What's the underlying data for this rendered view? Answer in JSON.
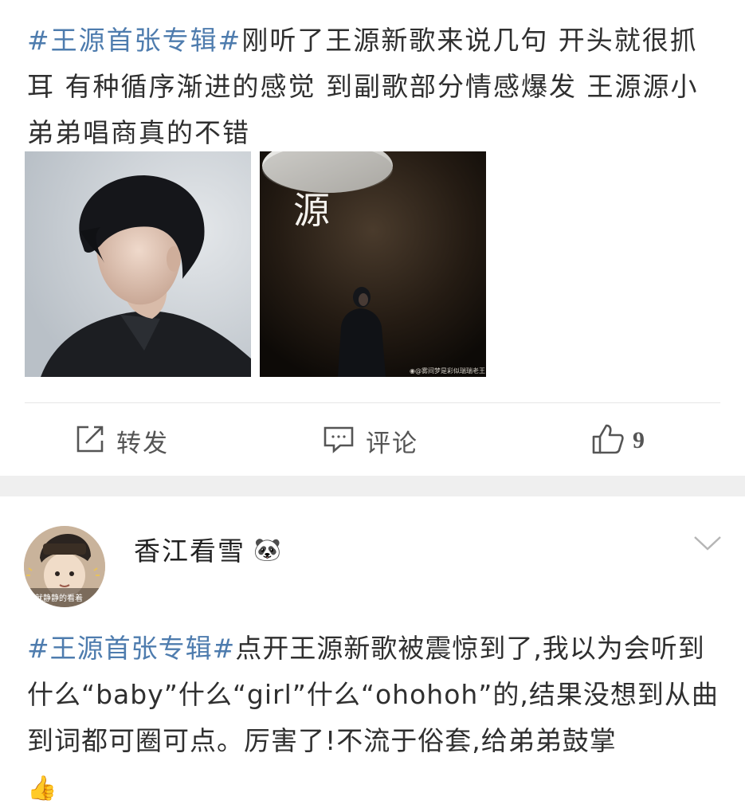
{
  "post1": {
    "hashtag": "#王源首张专辑#",
    "text": "刚听了王源新歌来说几句 开头就很抓耳 有种循序渐进的感觉 到副歌部分情感爆发 王源源小弟弟唱商真的不错",
    "image2_caption_char": "源",
    "image2_watermark": "@雾间梦是彩似瑞瑞老王",
    "actions": {
      "repost_label": "转发",
      "comment_label": "评论",
      "like_count": "9"
    }
  },
  "post2": {
    "username": "香江看雪",
    "username_badge": "🐼",
    "avatar_text": "我就静静的看着",
    "hashtag": "#王源首张专辑#",
    "text": "点开王源新歌被震惊到了,我以为会听到什么“baby”什么“girl”什么“ohohoh”的,结果没想到从曲到词都可圈可点。厉害了!不流于俗套,给弟弟鼓掌",
    "emoji": "👍"
  },
  "colors": {
    "hashtag": "#4e7cae",
    "text": "#2f2f2f",
    "divider": "#e5e5e5",
    "gap": "#efefef"
  },
  "icons": [
    "repost-icon",
    "comment-icon",
    "like-icon",
    "chevron-down-icon"
  ]
}
